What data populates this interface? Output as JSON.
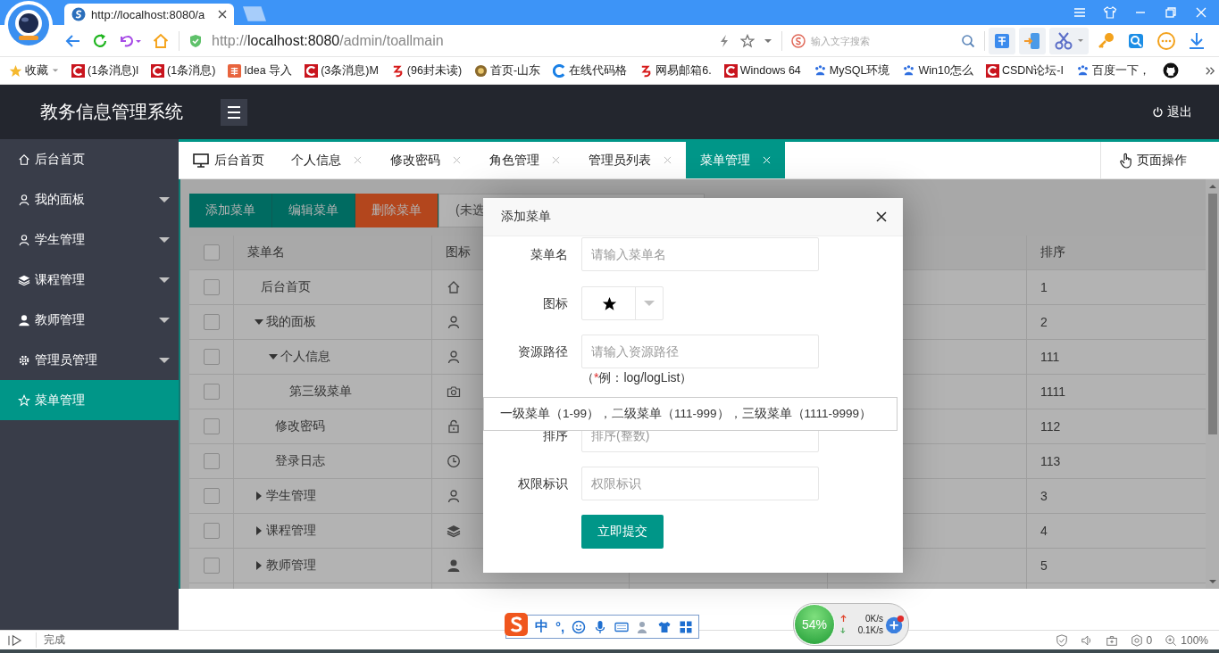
{
  "browser": {
    "tab": {
      "title": "http://localhost:8080/a"
    },
    "address": {
      "scheme": "http://",
      "host": "localhost:8080",
      "path": "/admin/toallmain"
    },
    "search": {
      "placeholder": "输入文字搜索"
    },
    "bookmarks": [
      {
        "label": "收藏",
        "kind": "star"
      },
      {
        "label": "(1条消息)l",
        "kind": "csdn"
      },
      {
        "label": "(1条消息)",
        "kind": "csdn"
      },
      {
        "label": "Idea 导入",
        "kind": "jian"
      },
      {
        "label": "(3条消息)M",
        "kind": "csdn"
      },
      {
        "label": "(96封未读)",
        "kind": "mail"
      },
      {
        "label": "首页-山东",
        "kind": "sun"
      },
      {
        "label": "在线代码格",
        "kind": "cblue"
      },
      {
        "label": "网易邮箱6.",
        "kind": "mail"
      },
      {
        "label": "Windows 64",
        "kind": "csdn"
      },
      {
        "label": "MySQL环境",
        "kind": "paw"
      },
      {
        "label": "Win10怎么",
        "kind": "paw"
      },
      {
        "label": "CSDN论坛-I",
        "kind": "csdn"
      },
      {
        "label": "百度一下，",
        "kind": "paw"
      }
    ],
    "status": {
      "text": "完成",
      "count": "0",
      "zoom": "100%"
    }
  },
  "app": {
    "title": "教务信息管理系统",
    "logout": "退出"
  },
  "sidebar": {
    "items": [
      {
        "label": "后台首页",
        "kind": "home",
        "has_submenu": false,
        "selected": false
      },
      {
        "label": "我的面板",
        "kind": "user",
        "has_submenu": true,
        "selected": false
      },
      {
        "label": "学生管理",
        "kind": "user",
        "has_submenu": true,
        "selected": false
      },
      {
        "label": "课程管理",
        "kind": "layers",
        "has_submenu": true,
        "selected": false
      },
      {
        "label": "教师管理",
        "kind": "person",
        "has_submenu": true,
        "selected": false
      },
      {
        "label": "管理员管理",
        "kind": "gear",
        "has_submenu": true,
        "selected": false
      },
      {
        "label": "菜单管理",
        "kind": "star",
        "has_submenu": false,
        "selected": true
      }
    ]
  },
  "tabs": [
    {
      "label": "后台首页",
      "closable": false,
      "selected": false
    },
    {
      "label": "个人信息",
      "closable": true,
      "selected": false
    },
    {
      "label": "修改密码",
      "closable": true,
      "selected": false
    },
    {
      "label": "角色管理",
      "closable": true,
      "selected": false
    },
    {
      "label": "管理员列表",
      "closable": true,
      "selected": false
    },
    {
      "label": "菜单管理",
      "closable": true,
      "selected": true
    }
  ],
  "page_actions": "页面操作",
  "toolbar": {
    "buttons": [
      {
        "label": "添加菜单",
        "kind": "primary"
      },
      {
        "label": "编辑菜单",
        "kind": "primary"
      },
      {
        "label": "删除菜单",
        "kind": "danger"
      }
    ],
    "selection_text": "(未选"
  },
  "table": {
    "columns": {
      "name": "菜单名",
      "icon": "图标",
      "sort": "排序"
    },
    "all_checked": false,
    "rows": [
      {
        "name": "后台首页",
        "kind": "home",
        "sort": "1",
        "checked": false
      },
      {
        "name": "我的面板",
        "kind": "user",
        "sort": "2",
        "checked": false,
        "expanded": true,
        "children": [
          {
            "name": "个人信息",
            "kind": "user",
            "sort": "111",
            "checked": false,
            "expanded": true,
            "children": [
              {
                "name": "第三级菜单",
                "kind": "camera",
                "sort": "1111",
                "checked": false
              }
            ]
          },
          {
            "name": "修改密码",
            "kind": "lock",
            "sort": "112",
            "checked": false
          },
          {
            "name": "登录日志",
            "kind": "clock",
            "sort": "113",
            "checked": false
          }
        ]
      },
      {
        "name": "学生管理",
        "kind": "user",
        "sort": "3",
        "checked": false,
        "expanded": false
      },
      {
        "name": "课程管理",
        "kind": "layers",
        "sort": "4",
        "checked": false,
        "expanded": false
      },
      {
        "name": "教师管理",
        "kind": "person",
        "sort": "5",
        "checked": false,
        "expanded": false
      }
    ]
  },
  "dialog": {
    "title": "添加菜单",
    "fields": [
      {
        "label": "菜单名",
        "kind": "text",
        "placeholder": "请输入菜单名"
      },
      {
        "label": "图标",
        "kind": "icon_select"
      },
      {
        "label": "资源路径",
        "kind": "text",
        "placeholder": "请输入资源路径",
        "hint": {
          "open": "（",
          "required_mark": "*",
          "text": "例：log/logList）"
        }
      },
      {
        "label": "排序",
        "kind": "text",
        "placeholder": "排序(整数)"
      },
      {
        "label": "权限标识",
        "kind": "text",
        "placeholder": "权限标识"
      }
    ],
    "tooltip": "一级菜单（1-99），二级菜单（111-999），三级菜单（1111-9999）",
    "submit": "立即提交"
  },
  "ime_toolbar": {
    "mode": "中",
    "punctuation": "°,"
  },
  "net_monitor": {
    "percent": "54%",
    "upload": "0K/s",
    "download": "0.1K/s"
  }
}
